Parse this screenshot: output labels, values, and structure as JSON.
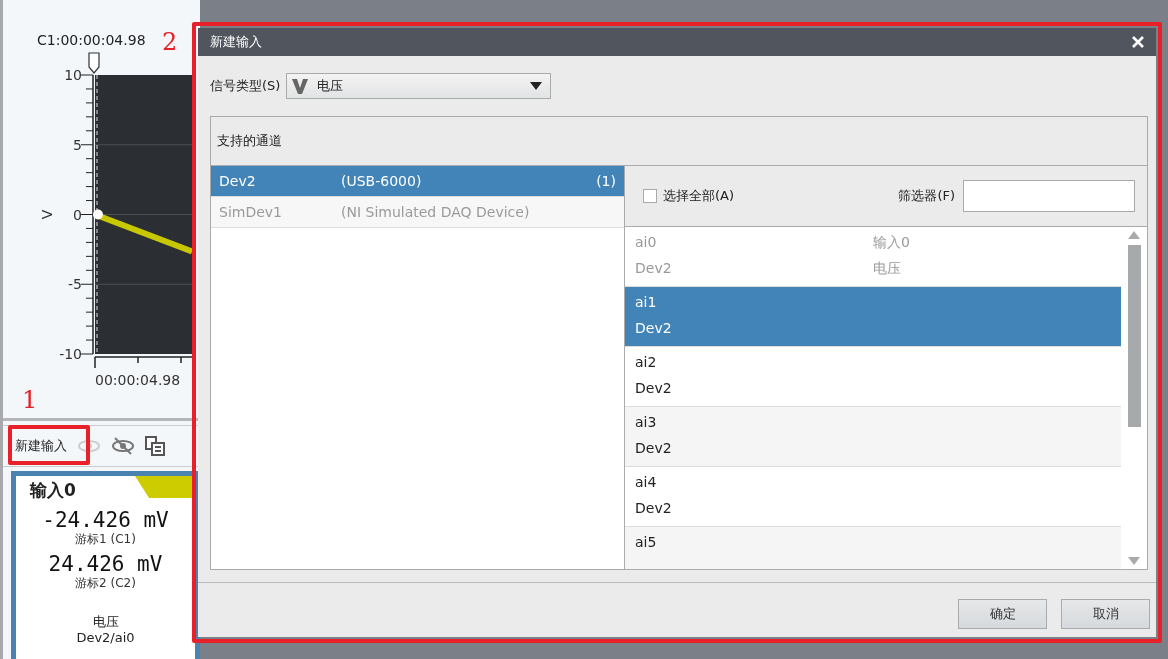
{
  "app": {
    "cursor_readout": "C1:00:00:04.98",
    "chart": {
      "y_unit": "V",
      "y_labels": [
        "10",
        "5",
        "0",
        "-5",
        "-10"
      ],
      "x_label": "00:00:04.98"
    },
    "toolbar": {
      "new_input": "新建输入"
    },
    "input_card": {
      "tab": "输入0",
      "readings": [
        {
          "value": "-24.426 mV",
          "label": "游标1 (C1)"
        },
        {
          "value": "24.426 mV",
          "label": "游标2 (C2)"
        }
      ],
      "signal": "电压",
      "channel": "Dev2/ai0"
    }
  },
  "callouts": [
    {
      "label": "1"
    },
    {
      "label": "2"
    }
  ],
  "dialog": {
    "title": "新建输入",
    "signal_type": {
      "label": "信号类型(S)",
      "value": "电压"
    },
    "channels_header": "支持的通道",
    "devices": [
      {
        "name": "Dev2",
        "model": "(USB-6000)",
        "count": "(1)",
        "selected": true,
        "disabled": false
      },
      {
        "name": "SimDev1",
        "model": "(NI Simulated DAQ Device)",
        "selected": false,
        "disabled": true
      }
    ],
    "select_all": {
      "label": "选择全部(A)",
      "checked": false
    },
    "filter": {
      "label": "筛选器(F)"
    },
    "channels": [
      {
        "name": "ai0",
        "device": "Dev2",
        "input": "输入0",
        "type": "电压",
        "selected": false,
        "disabled": true
      },
      {
        "name": "ai1",
        "device": "Dev2",
        "selected": true,
        "disabled": false
      },
      {
        "name": "ai2",
        "device": "Dev2",
        "selected": false,
        "disabled": false
      },
      {
        "name": "ai3",
        "device": "Dev2",
        "selected": false,
        "disabled": false
      },
      {
        "name": "ai4",
        "device": "Dev2",
        "selected": false,
        "disabled": false
      },
      {
        "name": "ai5",
        "selected": false,
        "disabled": false
      }
    ],
    "buttons": [
      {
        "label": "确定"
      },
      {
        "label": "取消"
      }
    ]
  }
}
